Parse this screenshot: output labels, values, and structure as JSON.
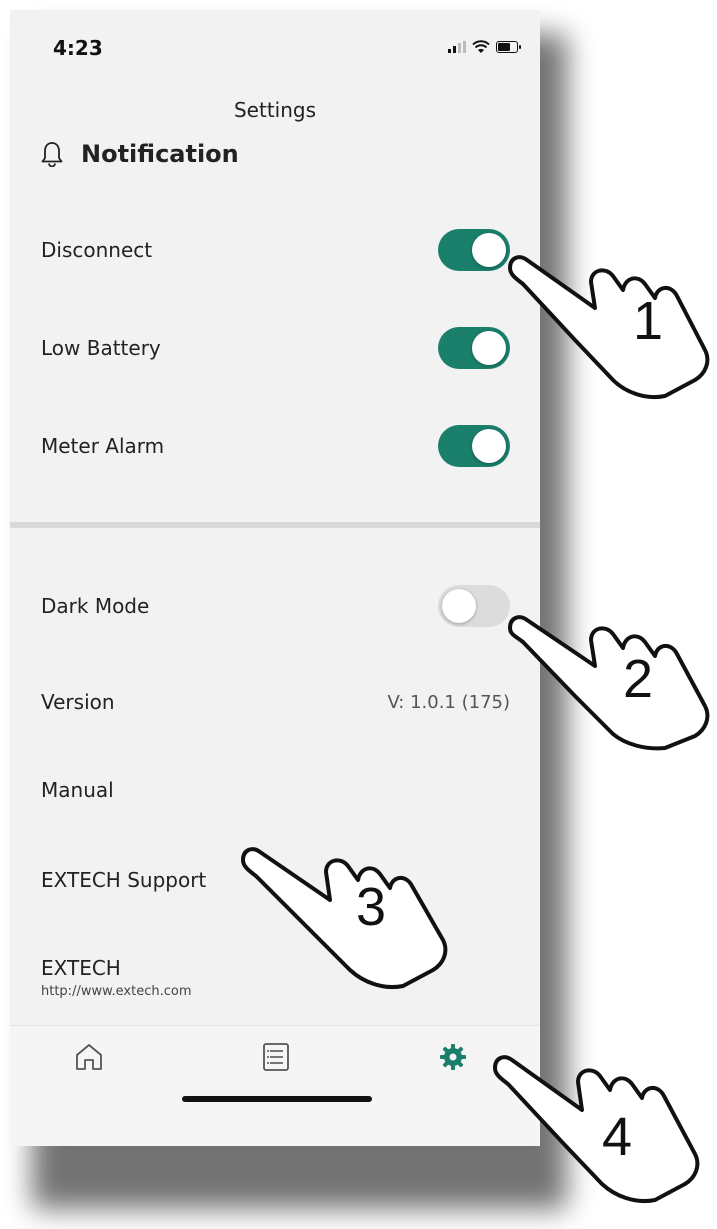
{
  "status_bar": {
    "time": "4:23"
  },
  "header": {
    "title": "Settings"
  },
  "notification_section": {
    "title": "Notification",
    "icon": "bell-icon",
    "items": [
      {
        "label": "Disconnect",
        "enabled": true
      },
      {
        "label": "Low Battery",
        "enabled": true
      },
      {
        "label": "Meter Alarm",
        "enabled": true
      }
    ]
  },
  "general_section": {
    "dark_mode": {
      "label": "Dark Mode",
      "enabled": false
    },
    "version": {
      "label": "Version",
      "value": "V: 1.0.1 (175)"
    },
    "manual": {
      "label": "Manual"
    },
    "support": {
      "label": "EXTECH Support"
    },
    "extech": {
      "label": "EXTECH",
      "url": "http://www.extech.com"
    }
  },
  "tabbar": {
    "items": [
      {
        "icon": "home-icon",
        "active": false
      },
      {
        "icon": "list-icon",
        "active": false
      },
      {
        "icon": "gear-icon",
        "active": true
      }
    ]
  },
  "callouts": [
    "1",
    "2",
    "3",
    "4"
  ],
  "colors": {
    "accent": "#1a7f6b",
    "background": "#f2f2f2",
    "toggle_off": "#dcdcdc"
  }
}
